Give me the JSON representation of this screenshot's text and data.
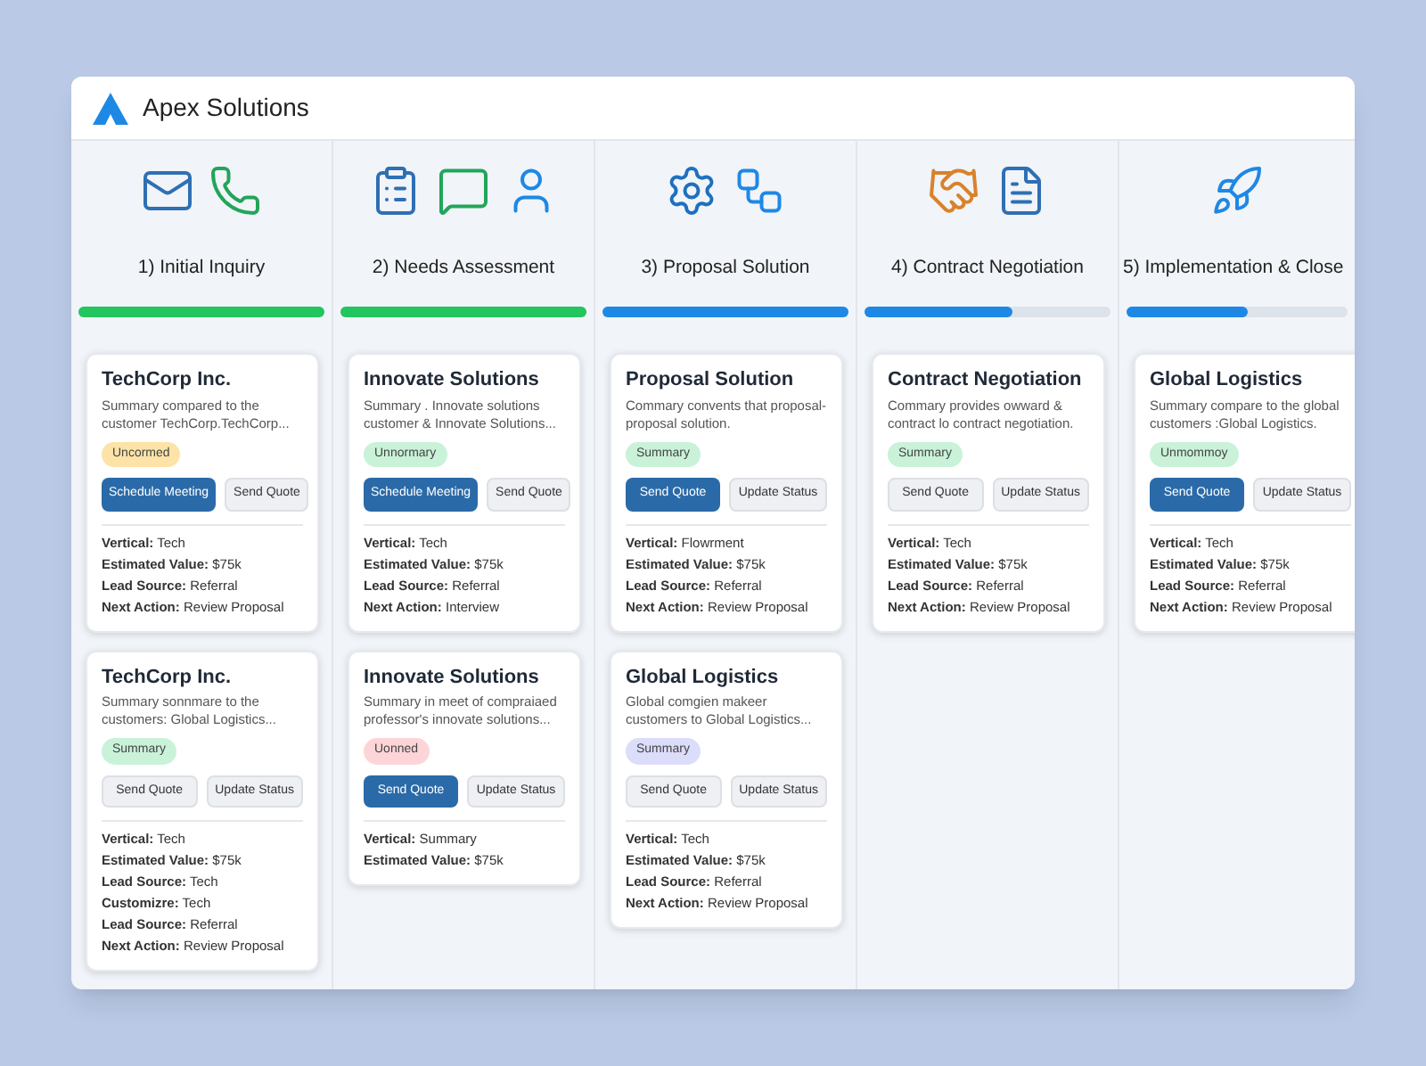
{
  "window": {
    "title": "Apex Solutions"
  },
  "stages": [
    {
      "label": "1) Initial Inquiry",
      "level": 1,
      "color": "#22c55e",
      "cards": [
        {
          "title": "TechCorp Inc.",
          "summary": "Summary compared to the customer TechCorp.TechCorp...",
          "badge": {
            "text": "Uncormed",
            "color": "#fde3a7"
          },
          "buttons": [
            {
              "label": "Schedule Meeting",
              "primary": true
            },
            {
              "label": "Send Quote",
              "primary": false
            }
          ],
          "fields": [
            {
              "label": "Vertical:",
              "value": "Tech"
            },
            {
              "label": "Estimated Value:",
              "value": "$75k"
            },
            {
              "label": "Lead Source:",
              "value": "Referral"
            },
            {
              "label": "Next Action:",
              "value": "Review Proposal"
            }
          ]
        },
        {
          "title": "TechCorp Inc.",
          "summary": "Summary sonnmare to the customers: Global Logistics...",
          "badge": {
            "text": "Summary",
            "color": "#c9f2d9"
          },
          "buttons": [
            {
              "label": "Send Quote",
              "primary": false
            },
            {
              "label": "Update Status",
              "primary": false
            }
          ],
          "fields": [
            {
              "label": "Vertical:",
              "value": "Tech"
            },
            {
              "label": "Estimated Value:",
              "value": "$75k"
            },
            {
              "label": "Lead Source:",
              "value": "Tech"
            },
            {
              "label": "Customizre:",
              "value": "Tech"
            },
            {
              "label": "Lead Source:",
              "value": "Referral"
            },
            {
              "label": "Next Action:",
              "value": "Review Proposal"
            }
          ]
        }
      ]
    },
    {
      "label": "2) Needs Assessment",
      "level": 1,
      "color": "#22c55e",
      "cards": [
        {
          "title": "Innovate Solutions",
          "summary": "Summary . Innovate solutions customer & Innovate Solutions...",
          "badge": {
            "text": "Unnormary",
            "color": "#c9f2d9"
          },
          "buttons": [
            {
              "label": "Schedule Meeting",
              "primary": true
            },
            {
              "label": "Send Quote",
              "primary": false
            }
          ],
          "fields": [
            {
              "label": "Vertical:",
              "value": "Tech"
            },
            {
              "label": "Estimated Value:",
              "value": "$75k"
            },
            {
              "label": "Lead Source:",
              "value": "Referral"
            },
            {
              "label": "Next Action:",
              "value": "Interview"
            }
          ]
        },
        {
          "title": "Innovate Solutions",
          "summary": "Summary in meet of compraiaed professor's innovate solutions...",
          "badge": {
            "text": "Uonned",
            "color": "#fdd5d8"
          },
          "buttons": [
            {
              "label": "Send Quote",
              "primary": true
            },
            {
              "label": "Update Status",
              "primary": false
            }
          ],
          "fields": [
            {
              "label": "Vertical:",
              "value": "Summary"
            },
            {
              "label": "Estimated Value:",
              "value": "$75k"
            }
          ]
        }
      ]
    },
    {
      "label": "3) Proposal Solution",
      "level": 1,
      "color": "#1e88e5",
      "cards": [
        {
          "title": "Proposal Solution",
          "summary": "Commary convents that proposal-proposal solution.",
          "badge": {
            "text": "Summary",
            "color": "#c9f2d9"
          },
          "buttons": [
            {
              "label": "Send Quote",
              "primary": true
            },
            {
              "label": "Update Status",
              "primary": false
            }
          ],
          "fields": [
            {
              "label": "Vertical:",
              "value": "Flowrment"
            },
            {
              "label": "Estimated Value:",
              "value": "$75k"
            },
            {
              "label": "Lead Source:",
              "value": "Referral"
            },
            {
              "label": "Next Action:",
              "value": "Review Proposal"
            }
          ]
        },
        {
          "title": "Global Logistics",
          "summary": "Global comgien makeer customers to Global Logistics...",
          "badge": {
            "text": "Summary",
            "color": "#dcdcfb"
          },
          "buttons": [
            {
              "label": "Send Quote",
              "primary": false
            },
            {
              "label": "Update Status",
              "primary": false
            }
          ],
          "fields": [
            {
              "label": "Vertical:",
              "value": "Tech"
            },
            {
              "label": "Estimated Value:",
              "value": "$75k"
            },
            {
              "label": "Lead Source:",
              "value": "Referral"
            },
            {
              "label": "Next Action:",
              "value": "Review Proposal"
            }
          ]
        }
      ]
    },
    {
      "label": "4) Contract Negotiation",
      "level": 0.6,
      "color": "#1e88e5",
      "cards": [
        {
          "title": "Contract Negotiation",
          "summary": "Commary provides owward & contract lo contract negotiation.",
          "badge": {
            "text": "Summary",
            "color": "#c9f2d9"
          },
          "buttons": [
            {
              "label": "Send Quote",
              "primary": false
            },
            {
              "label": "Update Status",
              "primary": false
            }
          ],
          "fields": [
            {
              "label": "Vertical:",
              "value": "Tech"
            },
            {
              "label": "Estimated Value:",
              "value": "$75k"
            },
            {
              "label": "Lead Source:",
              "value": "Referral"
            },
            {
              "label": "Next Action:",
              "value": "Review Proposal"
            }
          ]
        }
      ]
    },
    {
      "label": "5) Implementation & Close",
      "level": 0.55,
      "color": "#1e88e5",
      "cards": [
        {
          "title": "Global Logistics",
          "summary": "Summary compare to the global customers :Global Logistics.",
          "badge": {
            "text": "Unmommoy",
            "color": "#c9f2d9"
          },
          "buttons": [
            {
              "label": "Send Quote",
              "primary": true
            },
            {
              "label": "Update Status",
              "primary": false
            }
          ],
          "fields": [
            {
              "label": "Vertical:",
              "value": "Tech"
            },
            {
              "label": "Estimated Value:",
              "value": "$75k"
            },
            {
              "label": "Lead Source:",
              "value": "Referral"
            },
            {
              "label": "Next Action:",
              "value": "Review Proposal"
            }
          ]
        }
      ]
    }
  ]
}
